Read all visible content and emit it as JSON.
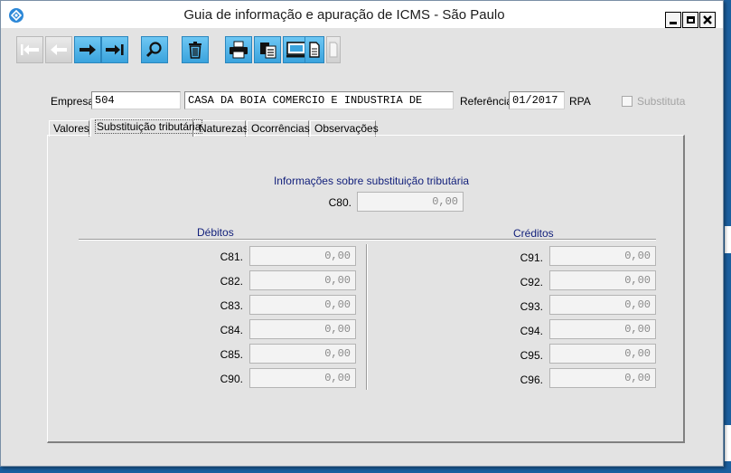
{
  "window": {
    "title": "Guia de informação e apuração de ICMS - São Paulo"
  },
  "toolbar": {
    "buttons": [
      {
        "name": "first-record",
        "icon": "arrow-first-icon",
        "enabled": false
      },
      {
        "name": "previous-record",
        "icon": "arrow-left-icon",
        "enabled": false
      },
      {
        "name": "next-record",
        "icon": "arrow-right-icon",
        "enabled": true
      },
      {
        "name": "last-record",
        "icon": "arrow-last-icon",
        "enabled": true
      },
      {
        "name": "search",
        "icon": "magnifier-icon",
        "enabled": true
      },
      {
        "name": "delete",
        "icon": "trash-icon",
        "enabled": true
      },
      {
        "name": "print",
        "icon": "printer-icon",
        "enabled": true
      },
      {
        "name": "print-copies",
        "icon": "print-copies-icon",
        "enabled": true
      },
      {
        "name": "preview",
        "icon": "monitor-icon",
        "enabled": true
      },
      {
        "name": "export",
        "icon": "document-icon",
        "enabled": true
      },
      {
        "name": "extra",
        "icon": "document-disabled-icon",
        "enabled": false
      }
    ]
  },
  "header": {
    "empresa_label": "Empresa",
    "empresa_code": "504",
    "empresa_name": "CASA DA BOIA COMERCIO E INDUSTRIA DE",
    "referencia_label": "Referência",
    "referencia_value": "01/2017",
    "rpa_label": "RPA",
    "substituta_label": "Substituta",
    "substituta_checked": false
  },
  "tabs": [
    {
      "label": "Valores",
      "active": false
    },
    {
      "label": "Substituição tributária",
      "active": true
    },
    {
      "label": "Naturezas",
      "active": false
    },
    {
      "label": "Ocorrências",
      "active": false
    },
    {
      "label": "Observações",
      "active": false
    }
  ],
  "panel": {
    "info_title": "Informações sobre substituição tributária",
    "c80_label": "C80.",
    "c80_value": "0,00",
    "debitos_title": "Débitos",
    "creditos_title": "Créditos",
    "debitos": [
      {
        "label": "C81.",
        "value": "0,00"
      },
      {
        "label": "C82.",
        "value": "0,00"
      },
      {
        "label": "C83.",
        "value": "0,00"
      },
      {
        "label": "C84.",
        "value": "0,00"
      },
      {
        "label": "C85.",
        "value": "0,00"
      },
      {
        "label": "C90.",
        "value": "0,00"
      }
    ],
    "creditos": [
      {
        "label": "C91.",
        "value": "0,00"
      },
      {
        "label": "C92.",
        "value": "0,00"
      },
      {
        "label": "C93.",
        "value": "0,00"
      },
      {
        "label": "C94.",
        "value": "0,00"
      },
      {
        "label": "C95.",
        "value": "0,00"
      },
      {
        "label": "C96.",
        "value": "0,00"
      }
    ]
  },
  "colors": {
    "accent": "#3aa3dd",
    "section_title": "#101e7a",
    "desktop": "#1b5f9e"
  }
}
